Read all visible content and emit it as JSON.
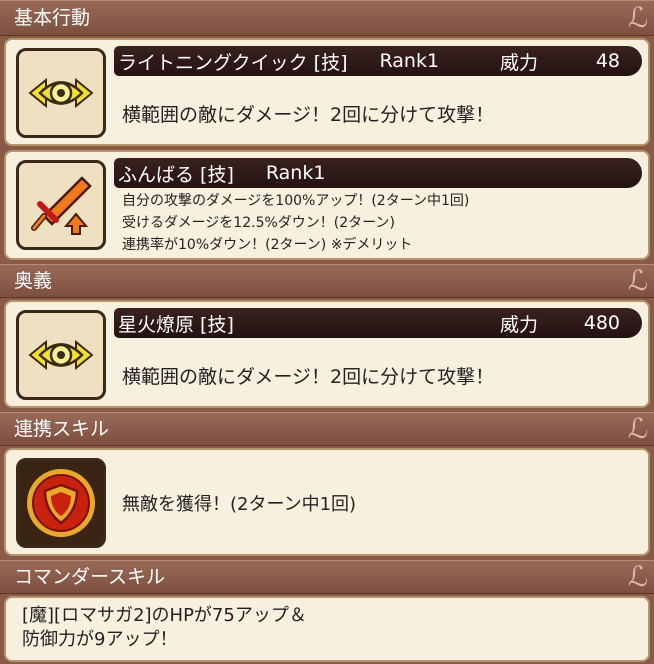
{
  "sections": {
    "basic": "基本行動",
    "ougi": "奥義",
    "renkei": "連携スキル",
    "commander": "コマンダースキル"
  },
  "cards": {
    "lightning": {
      "name": "ライトニングクイック [技]",
      "rank": "Rank1",
      "power_label": "威力",
      "power_value": "48",
      "desc": "横範囲の敵にダメージ！2回に分けて攻撃！",
      "icon": "eye-double-arrow-icon"
    },
    "funbaru": {
      "name": "ふんばる [技]",
      "rank": "Rank1",
      "lines": [
        "自分の攻撃のダメージを100%アップ！(2ターン中1回)",
        "受けるダメージを12.5%ダウン！(2ターン)",
        "連携率が10%ダウン！(2ターン) ※デメリット"
      ],
      "icon": "sword-up-arrow-icon"
    },
    "seika": {
      "name": "星火燎原 [技]",
      "power_label": "威力",
      "power_value": "480",
      "desc": "横範囲の敵にダメージ！2回に分けて攻撃！",
      "icon": "eye-double-arrow-icon"
    },
    "renkei": {
      "desc": "無敵を獲得！(2ターン中1回)",
      "icon": "shield-emblem-icon"
    },
    "commander": {
      "lines": [
        "[魔][ロマサガ2]のHPが75アップ＆",
        "防御力が9アップ！"
      ]
    }
  },
  "colors": {
    "background": "#8a5a48",
    "card": "#f7f0df",
    "title_bar": "#2c1818",
    "eye_icon_yellow": "#f3e02a",
    "sword_orange": "#f07a1a",
    "shield_red": "#c8220e"
  }
}
